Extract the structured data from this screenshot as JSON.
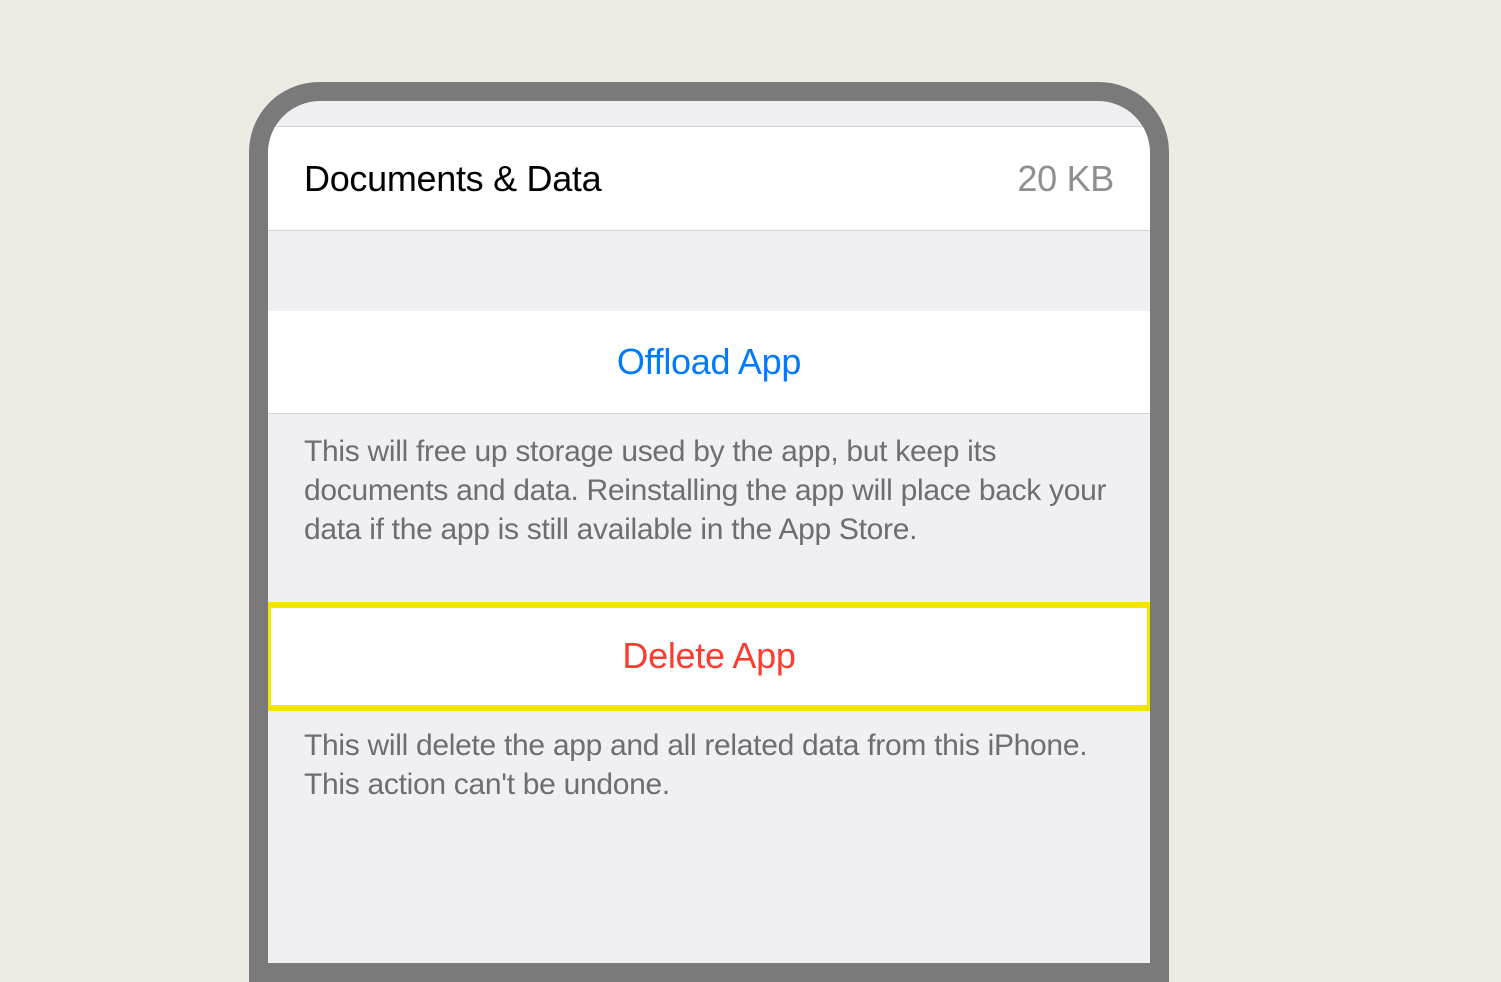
{
  "storage": {
    "documents_label": "Documents & Data",
    "documents_value": "20 KB"
  },
  "offload": {
    "button_label": "Offload App",
    "description": "This will free up storage used by the app, but keep its documents and data. Reinstalling the app will place back your data if the app is still available in the App Store."
  },
  "delete": {
    "button_label": "Delete App",
    "description": "This will delete the app and all related data from this iPhone. This action can't be undone."
  }
}
